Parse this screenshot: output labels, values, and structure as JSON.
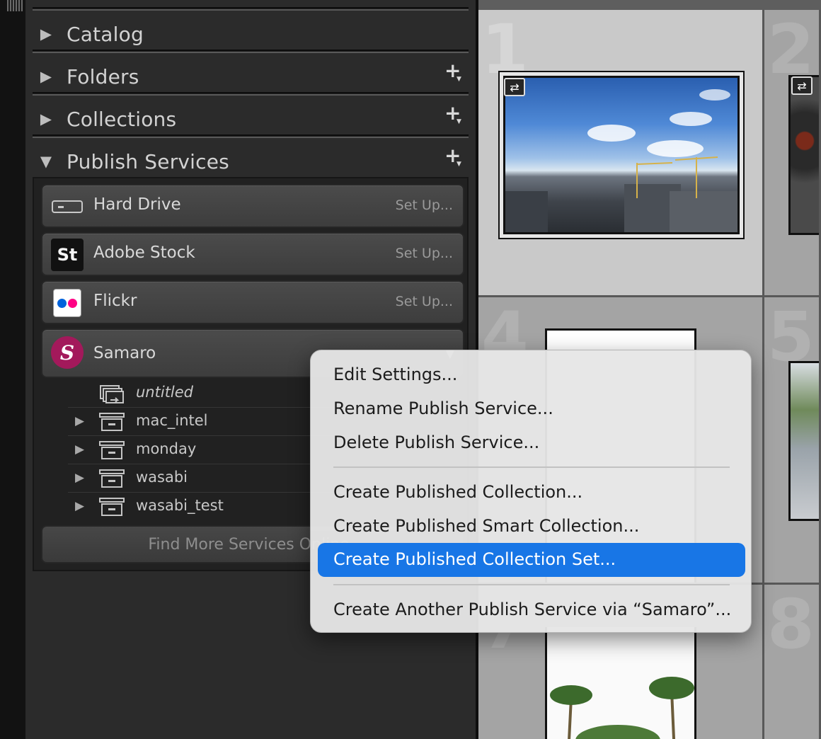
{
  "panel": {
    "sections": [
      {
        "title": "Catalog",
        "expanded": false,
        "has_add": false
      },
      {
        "title": "Folders",
        "expanded": false,
        "has_add": true
      },
      {
        "title": "Collections",
        "expanded": false,
        "has_add": true
      },
      {
        "title": "Publish Services",
        "expanded": true,
        "has_add": true
      }
    ],
    "add_glyph": "+",
    "collapsed_glyph": "▶",
    "expanded_glyph": "▼"
  },
  "services": [
    {
      "label": "Hard Drive",
      "action": "Set Up...",
      "icon": "hard-drive-icon"
    },
    {
      "label": "Adobe Stock",
      "action": "Set Up...",
      "icon": "adobe-stock-icon",
      "icon_text": "St"
    },
    {
      "label": "Flickr",
      "action": "Set Up...",
      "icon": "flickr-icon",
      "dot_colors": [
        "#0063dc",
        "#ff0084"
      ]
    },
    {
      "label": "Samaro",
      "icon": "samaro-icon",
      "icon_text": "S",
      "icon_color": "#a3195b"
    }
  ],
  "samaro_collections": [
    {
      "label": "untitled",
      "italic": true,
      "icon": "smart-collection-icon"
    },
    {
      "label": "mac_intel",
      "icon": "collection-set-icon"
    },
    {
      "label": "monday",
      "icon": "collection-set-icon"
    },
    {
      "label": "wasabi",
      "icon": "collection-set-icon"
    },
    {
      "label": "wasabi_test",
      "icon": "collection-set-icon"
    }
  ],
  "find_more_label": "Find More Services Online...",
  "grid": {
    "cells": [
      "1",
      "2",
      "4",
      "5",
      "7",
      "8"
    ],
    "selected_cell": "1"
  },
  "context_menu": {
    "groups": [
      [
        "Edit Settings...",
        "Rename Publish Service...",
        "Delete Publish Service..."
      ],
      [
        "Create Published Collection...",
        "Create Published Smart Collection...",
        "Create Published Collection Set..."
      ],
      [
        "Create Another Publish Service via “Samaro”..."
      ]
    ],
    "highlighted": "Create Published Collection Set...",
    "highlight_color": "#1876e6"
  }
}
